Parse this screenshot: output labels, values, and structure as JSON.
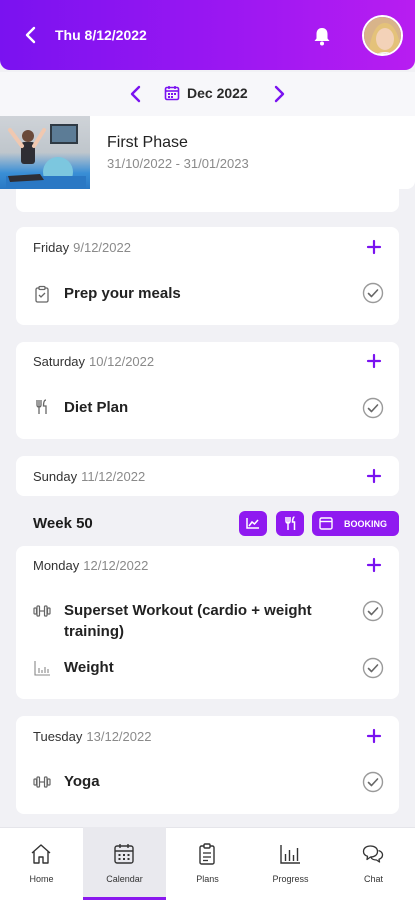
{
  "header": {
    "date": "Thu 8/12/2022"
  },
  "month_nav": {
    "label": "Dec 2022"
  },
  "phase": {
    "title": "First Phase",
    "dates": "31/10/2022 - 31/01/2023"
  },
  "days": [
    {
      "day": "Friday",
      "date": "9/12/2022",
      "tasks": [
        {
          "label": "Prep your meals",
          "icon": "clipboard-icon"
        }
      ]
    },
    {
      "day": "Saturday",
      "date": "10/12/2022",
      "tasks": [
        {
          "label": "Diet Plan",
          "icon": "fork-knife-icon"
        }
      ]
    },
    {
      "day": "Sunday",
      "date": "11/12/2022",
      "tasks": []
    },
    {
      "day": "Monday",
      "date": "12/12/2022",
      "tasks": [
        {
          "label": "Superset Workout (cardio + weight training)",
          "icon": "dumbbell-icon"
        },
        {
          "label": "Weight",
          "icon": "bar-chart-icon"
        }
      ]
    },
    {
      "day": "Tuesday",
      "date": "13/12/2022",
      "tasks": [
        {
          "label": "Yoga",
          "icon": "dumbbell-icon"
        }
      ]
    }
  ],
  "week": {
    "label": "Week 50",
    "booking_label": "BOOKING"
  },
  "nav": {
    "items": [
      {
        "label": "Home"
      },
      {
        "label": "Calendar"
      },
      {
        "label": "Plans"
      },
      {
        "label": "Progress"
      },
      {
        "label": "Chat"
      }
    ],
    "active": "Calendar"
  },
  "colors": {
    "accent": "#8a18ee",
    "header_start": "#7a12f0",
    "header_end": "#b81df1",
    "check": "#9a9a9a"
  }
}
